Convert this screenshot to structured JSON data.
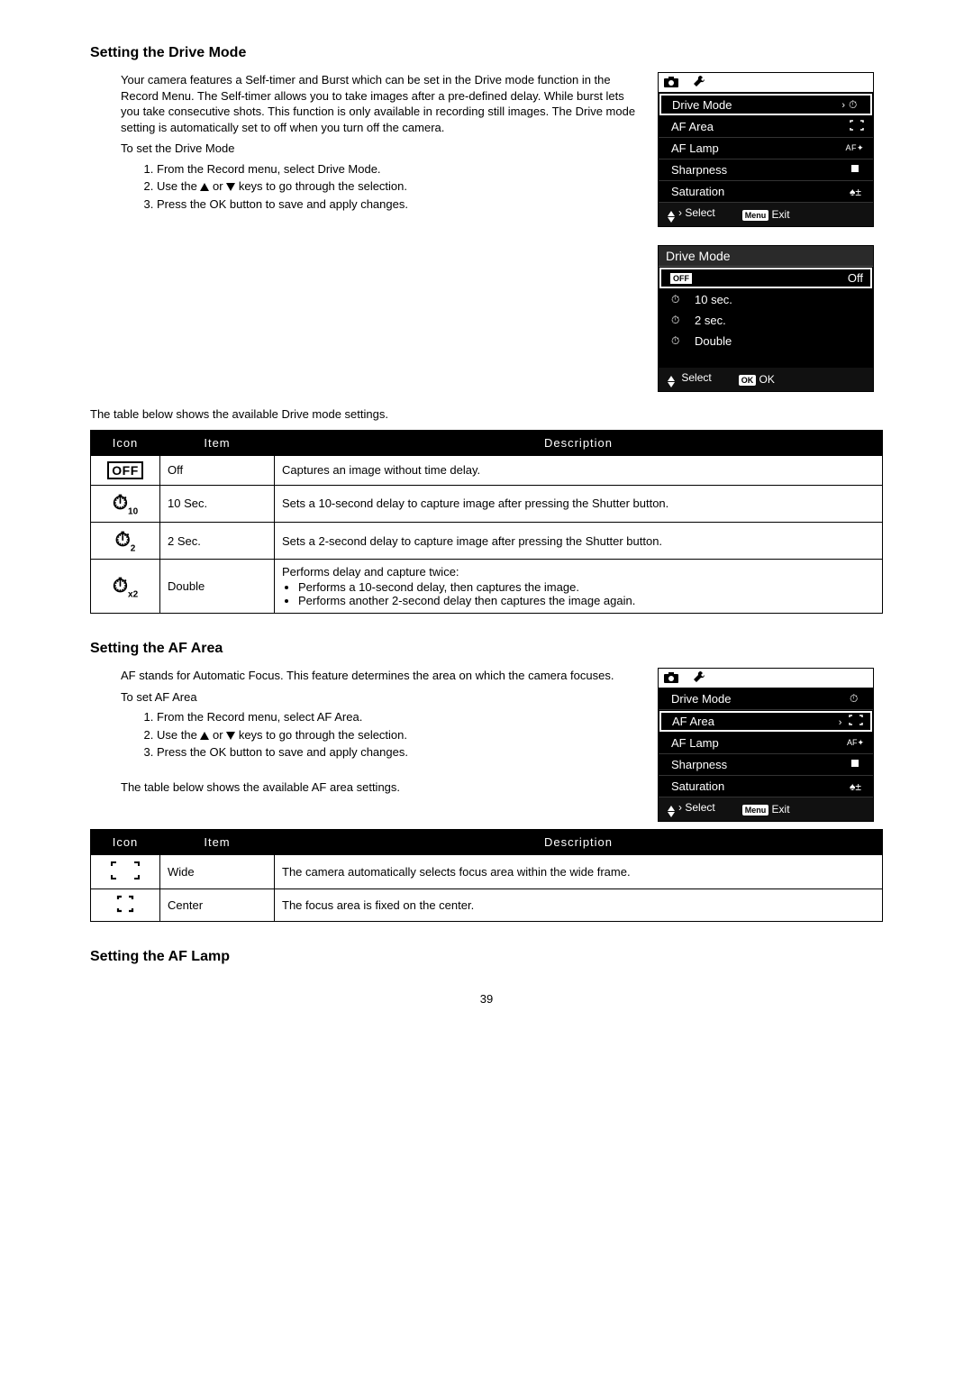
{
  "page_number": "39",
  "drive": {
    "heading": "Setting the Drive Mode",
    "intro": "Your camera features a Self-timer and Burst which can be set in the Drive mode function in the Record Menu. The Self-timer allows you to take images after a pre-defined delay. While burst lets you take consecutive shots. This function is only available in recording still images. The Drive mode setting is automatically set to off when you turn off the camera.",
    "subhead": "To set the Drive Mode",
    "steps": [
      "From the Record menu, select Drive Mode.",
      "Use the ▲ or ▼ keys to go through the selection.",
      "Press the OK button to save and apply changes."
    ],
    "table_intro": "The table below shows the available Drive mode settings.",
    "table_headers": {
      "icon": "Icon",
      "item": "Item",
      "desc": "Description"
    },
    "table": [
      {
        "item": "Off",
        "desc": "Captures an image without time delay."
      },
      {
        "item": "10 Sec.",
        "desc": "Sets a 10-second delay to capture image after pressing the Shutter button."
      },
      {
        "item": "2 Sec.",
        "desc": "Sets a 2-second delay to capture image after pressing the Shutter button."
      },
      {
        "item": "Double",
        "desc": "Performs delay and capture twice:",
        "bullets": [
          "Performs a 10-second delay, then captures the image.",
          "Performs another 2-second delay then captures the image again."
        ]
      }
    ],
    "menu1": {
      "items": [
        "Drive Mode",
        "AF Area",
        "AF Lamp",
        "Sharpness",
        "Saturation"
      ],
      "footer_select": "Select",
      "footer_exit": "Exit",
      "menu_badge": "Menu",
      "af_lamp_icon_text": "AF"
    },
    "menu2": {
      "title": "Drive Mode",
      "options": [
        "Off",
        "10 sec.",
        "2 sec.",
        "Double"
      ],
      "footer_select": "Select",
      "footer_ok": "OK",
      "ok_badge": "OK"
    }
  },
  "afarea": {
    "heading": "Setting the AF Area",
    "intro": "AF stands for Automatic Focus. This feature determines the area on which the camera focuses.",
    "subhead": "To set AF Area",
    "steps": [
      "From the Record menu, select AF Area.",
      "Use the ▲ or ▼ keys to go through the selection.",
      "Press the OK button to save and apply changes."
    ],
    "table_intro": "The table below shows the available AF area settings.",
    "table_headers": {
      "icon": "Icon",
      "item": "Item",
      "desc": "Description"
    },
    "table": [
      {
        "item": "Wide",
        "desc": "The camera automatically selects focus area within the wide frame."
      },
      {
        "item": "Center",
        "desc": "The focus area is fixed on the center."
      }
    ],
    "menu": {
      "items": [
        "Drive Mode",
        "AF Area",
        "AF Lamp",
        "Sharpness",
        "Saturation"
      ],
      "footer_select": "Select",
      "footer_exit": "Exit",
      "menu_badge": "Menu",
      "af_lamp_icon_text": "AF"
    }
  },
  "aflamp": {
    "heading": "Setting the AF Lamp"
  }
}
